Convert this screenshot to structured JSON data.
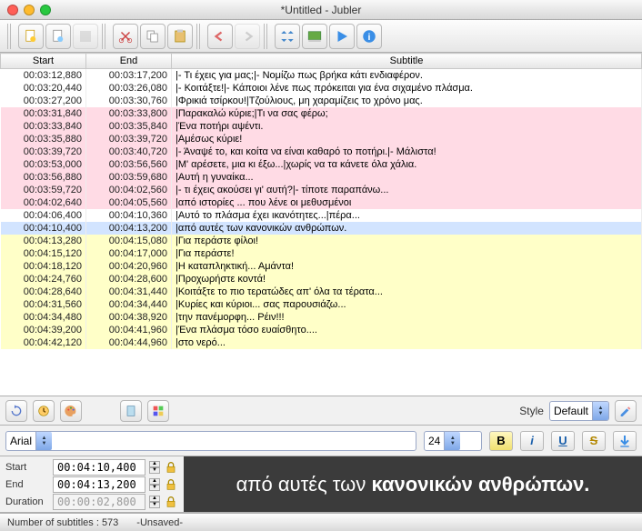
{
  "window": {
    "title": "*Untitled - Jubler"
  },
  "columns": {
    "start": "Start",
    "end": "End",
    "subtitle": "Subtitle"
  },
  "rows": [
    {
      "c": "normal",
      "s": "00:03:12,880",
      "e": "00:03:17,200",
      "t": "|- Τι έχεις για μας;|- Νομίζω πως βρήκα κάτι ενδιαφέρον."
    },
    {
      "c": "normal",
      "s": "00:03:20,440",
      "e": "00:03:26,080",
      "t": "|- Κοιτάξτε!|- Κάποιοι λένε πως πρόκειται για ένα σιχαμένο πλάσμα."
    },
    {
      "c": "normal",
      "s": "00:03:27,200",
      "e": "00:03:30,760",
      "t": "|Φρικιά τσίρκου!|Τζούλιους, μη χαραμίζεις το χρόνο μας."
    },
    {
      "c": "pink",
      "s": "00:03:31,840",
      "e": "00:03:33,800",
      "t": "|Παρακαλώ κύριε;|Τι να σας φέρω;"
    },
    {
      "c": "pink",
      "s": "00:03:33,840",
      "e": "00:03:35,840",
      "t": "|Ένα ποτήρι αψέντι."
    },
    {
      "c": "pink",
      "s": "00:03:35,880",
      "e": "00:03:39,720",
      "t": "|Αμέσως κύριε!"
    },
    {
      "c": "pink",
      "s": "00:03:39,720",
      "e": "00:03:40,720",
      "t": "|- Άναψέ το, και κοίτα να είναι καθαρό το ποτήρι.|- Μάλιστα!"
    },
    {
      "c": "pink",
      "s": "00:03:53,000",
      "e": "00:03:56,560",
      "t": "|Μ' αρέσετε, μια κι έξω...|χωρίς να τα κάνετε όλα χάλια."
    },
    {
      "c": "pink",
      "s": "00:03:56,880",
      "e": "00:03:59,680",
      "t": "|Αυτή η γυναίκα..."
    },
    {
      "c": "pink",
      "s": "00:03:59,720",
      "e": "00:04:02,560",
      "t": "|- τι έχεις ακούσει γι' αυτή?|- τίποτε παραπάνω..."
    },
    {
      "c": "pink",
      "s": "00:04:02,640",
      "e": "00:04:05,560",
      "t": "|από ιστορίες ... που λένε οι μεθυσμένοι"
    },
    {
      "c": "normal",
      "s": "00:04:06,400",
      "e": "00:04:10,360",
      "t": "|Αυτό το πλάσμα έχει ικανότητες...|πέρα..."
    },
    {
      "c": "blue",
      "s": "00:04:10,400",
      "e": "00:04:13,200",
      "t": "|από αυτές των κανονικών ανθρώπων."
    },
    {
      "c": "yellow",
      "s": "00:04:13,280",
      "e": "00:04:15,080",
      "t": "|Για περάστε φίλοι!"
    },
    {
      "c": "yellow",
      "s": "00:04:15,120",
      "e": "00:04:17,000",
      "t": "|Για περάστε!"
    },
    {
      "c": "yellow",
      "s": "00:04:18,120",
      "e": "00:04:20,960",
      "t": "|Η καταπληκτική... Αμάντα!"
    },
    {
      "c": "yellow",
      "s": "00:04:24,760",
      "e": "00:04:28,600",
      "t": "|Προχωρήστε κοντά!"
    },
    {
      "c": "yellow",
      "s": "00:04:28,640",
      "e": "00:04:31,440",
      "t": "|Κοιτάξτε το πιο τερατώδες απ' όλα τα τέρατα..."
    },
    {
      "c": "yellow",
      "s": "00:04:31,560",
      "e": "00:04:34,440",
      "t": "|Κυρίες και κύριοι... σας παρουσιάζω..."
    },
    {
      "c": "yellow",
      "s": "00:04:34,480",
      "e": "00:04:38,920",
      "t": "|την πανέμορφη... Ρέιν!!!"
    },
    {
      "c": "yellow",
      "s": "00:04:39,200",
      "e": "00:04:41,960",
      "t": "|Ένα πλάσμα τόσο ευαίσθητο...."
    },
    {
      "c": "yellow",
      "s": "00:04:42,120",
      "e": "00:04:44,960",
      "t": "|στο νερό..."
    }
  ],
  "style": {
    "label": "Style",
    "value": "Default"
  },
  "font": {
    "family": "Arial",
    "size": "24"
  },
  "format": {
    "bold": "B",
    "italic": "i",
    "underline": "U",
    "strike": "S"
  },
  "times": {
    "start_label": "Start",
    "start": "00:04:10,400",
    "end_label": "End",
    "end": "00:04:13,200",
    "duration_label": "Duration",
    "duration": "00:00:02,800"
  },
  "preview": {
    "prefix": "από αυτές των ",
    "bold": "κανονικών ανθρώπων."
  },
  "status": {
    "count_label": "Number of subtitles : ",
    "count": "573",
    "saved": "-Unsaved-"
  }
}
